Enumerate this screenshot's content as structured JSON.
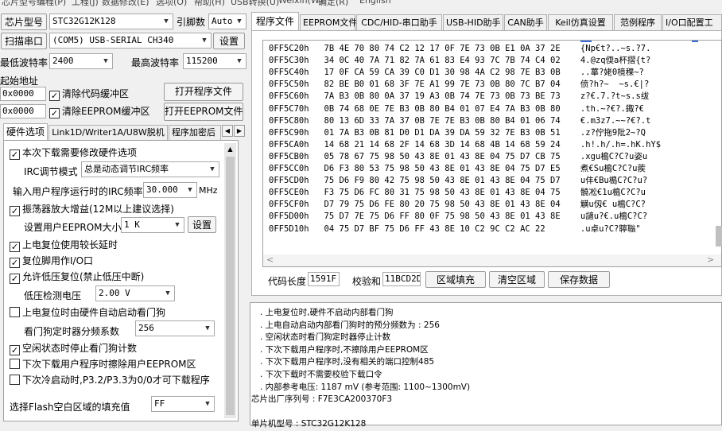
{
  "menu": [
    "芯片型号",
    "编程(P)",
    "工程(J)",
    "数据修改(E)",
    "选项(O)",
    "帮助(H)",
    "USB转换(U)",
    "Weixin(W)",
    "确定(R)",
    "English"
  ],
  "left": {
    "chip_type_btn": "芯片型号",
    "chip_type_val": "STC32G12K128",
    "pin_label": "引脚数",
    "pin_val": "Auto",
    "scan_btn": "扫描串口",
    "port_val": "(COM5) USB-SERIAL CH340",
    "settings_btn": "设置",
    "min_baud_label": "最低波特率",
    "min_baud_val": "2400",
    "max_baud_label": "最高波特率",
    "max_baud_val": "115200",
    "start_addr_label": "起始地址",
    "code_addr": "0x0000",
    "clear_code_label": "清除代码缓冲区",
    "open_prog_btn": "打开程序文件",
    "eeprom_addr": "0x0000",
    "clear_eeprom_label": "清除EEPROM缓冲区",
    "open_eeprom_btn": "打开EEPROM文件",
    "tabs": [
      "硬件选项",
      "Link1D/Writer1A/U8W脱机",
      "程序加密后"
    ],
    "opts": {
      "need_modify": "本次下载需要修改硬件选项",
      "irc_mode_label": "IRC调节模式",
      "irc_mode_val": "总是动态调节IRC频率",
      "irc_freq_label": "输入用户程序运行时的IRC频率",
      "irc_freq_val": "30.000",
      "irc_unit": "MHz",
      "osc_gain": "振荡器放大增益(12M以上建议选择)",
      "eeprom_size_label": "设置用户EEPROM大小",
      "eeprom_size_val": "1   K",
      "eeprom_set_btn": "设置",
      "long_reset": "上电复位使用较长延时",
      "reset_pin": "复位脚用作I/O口",
      "lvd_reset": "允许低压复位(禁止低压中断)",
      "lvd_label": "低压检测电压",
      "lvd_val": "2.00 V",
      "wdt_auto": "上电复位时由硬件自动启动看门狗",
      "wdt_div_label": "看门狗定时器分频系数",
      "wdt_div_val": "256",
      "idle_wdt": "空闲状态时停止看门狗计数",
      "erase_eeprom": "下次下载用户程序时擦除用户EEPROM区",
      "p32_cold": "下次冷启动时,P3.2/P3.3为0/0才可下载程序",
      "fill_label": "选择Flash空白区域的填充值",
      "fill_val": "FF"
    },
    "checks": {
      "clear_code": true,
      "clear_eeprom": true,
      "need_modify": true,
      "osc_gain": true,
      "long_reset": true,
      "reset_pin": true,
      "lvd_reset": true,
      "wdt_auto": false,
      "idle_wdt": true,
      "erase_eeprom": false,
      "p32_cold": false
    }
  },
  "right": {
    "tabs": [
      "程序文件",
      "EEPROM文件",
      "CDC/HID-串口助手",
      "USB-HID助手",
      "CAN助手",
      "Keil仿真设置",
      "范例程序",
      "I/O口配置工"
    ],
    "hex_rows": [
      "0FF5C20h   7B 4E 70 80 74 C2 12 17 0F 7E 73 0B E1 0A 37 2E    {Np€t?..~s.?7.",
      "0FF5C30h   34 0C 40 7A 71 82 7A 61 83 E4 93 7C 7B 74 C4 02    4.@zq偄a杯摺{t?",
      "0FF5C40h   17 0F CA 59 CA 39 C0 D1 30 98 4A C2 98 7E B3 0B    ..蕐?姥0樈稞~?",
      "0FF5C50h   82 BE B0 01 68 3F 7E A1 99 7E 73 0B 80 7C B7 04    偾?h?~  ~s.€|?",
      "0FF5C60h   7A B3 0B 80 0A 37 19 A3 0B 74 7E 73 0B 73 BE 73    z?€.7.?t~s.s绂",
      "0FF5C70h   0B 74 68 0E 7E B3 0B 80 B4 01 07 E4 7A B3 0B 80    .th.~?€?.鋷?€",
      "0FF5C80h   80 13 6D 33 7A 37 0B 7E 7E B3 0B 80 B4 01 06 74    €.m3z7.~~?€?.t",
      "0FF5C90h   01 7A B3 0B 81 D0 D1 DA 39 DA 59 32 7E B3 0B 51    .z?佇拖9阰2~?Q",
      "0FF5CA0h   14 68 21 14 68 2F 14 68 3D 14 68 4B 14 68 59 24    .h!.h/.h=.hK.hY$",
      "0FF5CB0h   05 78 67 75 98 50 43 8E 01 43 8E 04 75 D7 CB 75    .xgu槝C?C?u姿u",
      "0FF5CC0h   D6 F3 80 53 75 98 50 43 8E 01 43 8E 04 75 D7 E5    煮€Su槝C?C?u蒺",
      "0FF5CD0h   75 D6 F9 80 42 75 98 50 43 8E 01 43 8E 04 75 D7    u仹€Bu槝C?C?u?",
      "0FF5CE0h   F3 75 D6 FC 80 31 75 98 50 43 8E 01 43 8E 04 75    髐凇€1u槝C?C?u",
      "0FF5CF0h   D7 79 75 D6 FE 80 20 75 98 50 43 8E 01 43 8E 04    觵u仭€ u槝C?C?",
      "0FF5D00h   75 D7 7E 75 D6 FF 80 0F 75 98 50 43 8E 01 43 8E    u讁u?€.u槝C?C?",
      "0FF5D10h   04 75 D7 BF 75 D6 FF 43 8E 10 C2 9C C2 AC 22       .u卓u?C?聹聬\""
    ],
    "code_len_label": "代码长度",
    "code_len_val": "1591F",
    "checksum_label": "校验和",
    "checksum_val": "11BCD2D",
    "fill_btn": "区域填充",
    "clear_btn": "清空区域",
    "save_btn": "保存数据",
    "log": [
      ". 上电复位时,硬件不启动内部看门狗",
      ". 上电自动启动内部看门狗时的预分频数为 : 256",
      ". 空闲状态时看门狗定时器停止计数",
      ". 下次下载用户程序时,不擦除用户EEPROM区",
      ". 下次下载用户程序时,没有相关的端口控制485",
      ". 下次下载时不需要校验下载口令",
      ". 内部参考电压: 1187 mV (参考范围: 1100~1300mV)",
      "芯片出厂序列号 : F7E3CA200370F3",
      "",
      "单片机型号 : STC32G12K128"
    ]
  }
}
